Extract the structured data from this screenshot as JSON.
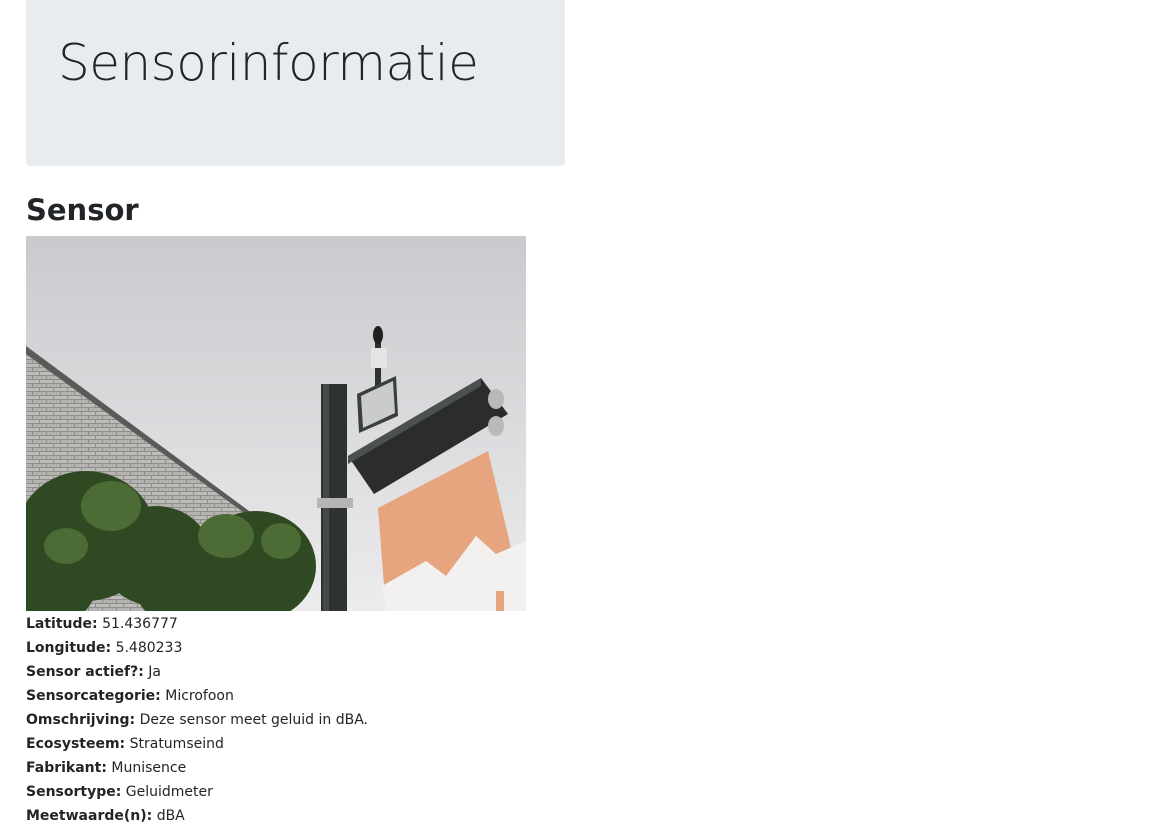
{
  "header": {
    "title": "Sensorinformatie"
  },
  "section": {
    "title": "Sensor"
  },
  "image": {
    "subject": "noise sensor mounted on street pole with banner"
  },
  "properties": [
    {
      "label": "Latitude:",
      "value": "51.436777"
    },
    {
      "label": "Longitude:",
      "value": "5.480233"
    },
    {
      "label": "Sensor actief?:",
      "value": "Ja"
    },
    {
      "label": "Sensorcategorie:",
      "value": "Microfoon"
    },
    {
      "label": "Omschrijving:",
      "value": "Deze sensor meet geluid in dBA."
    },
    {
      "label": "Ecosysteem:",
      "value": "Stratumseind"
    },
    {
      "label": "Fabrikant:",
      "value": "Munisence"
    },
    {
      "label": "Sensortype:",
      "value": "Geluidmeter"
    },
    {
      "label": "Meetwaarde(n):",
      "value": "dBA"
    }
  ],
  "colors": {
    "jumbotron_bg": "#e9ecef",
    "text": "#212529",
    "sky": "#dcdde0",
    "banner": "#e8a582"
  }
}
